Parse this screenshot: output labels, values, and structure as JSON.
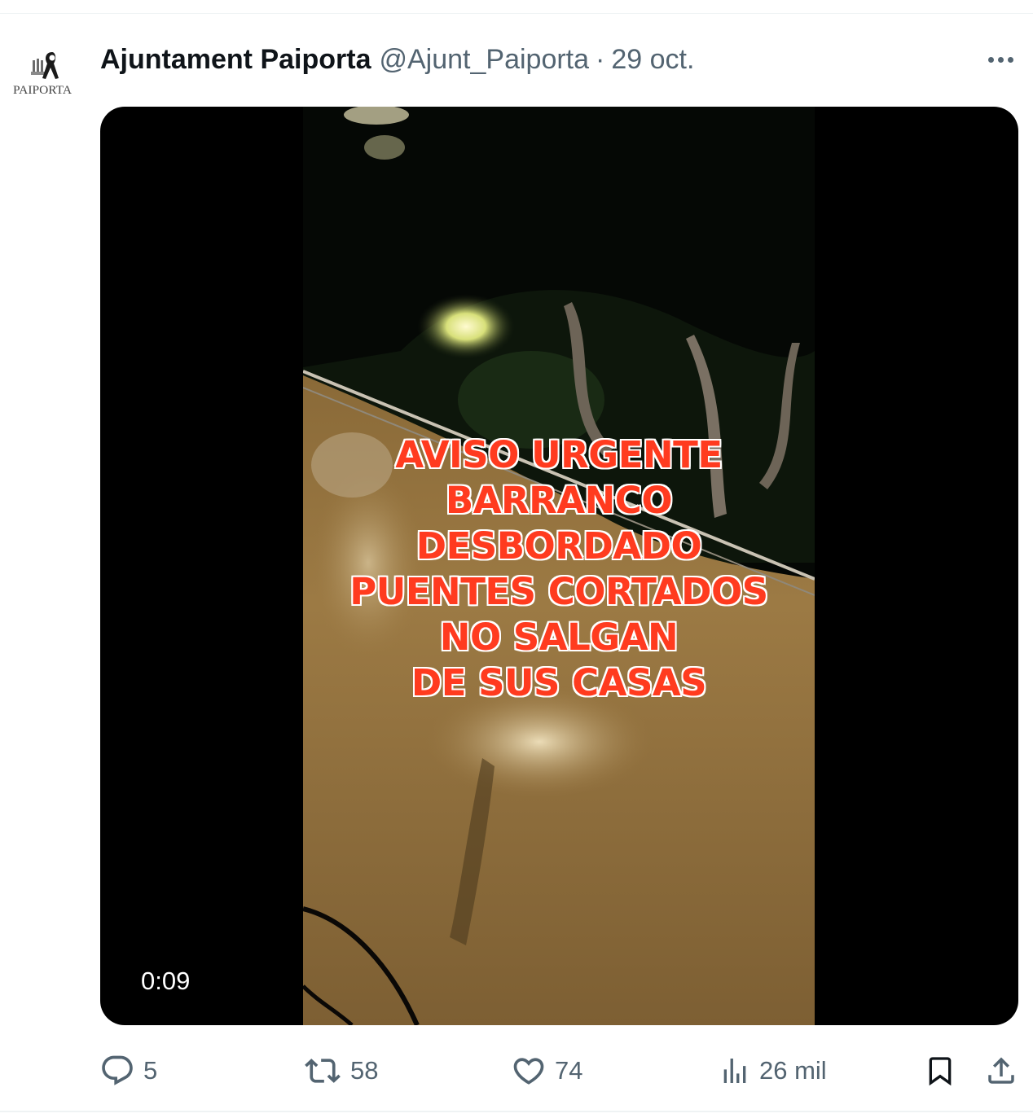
{
  "tweet": {
    "author": {
      "display_name": "Ajuntament Paiporta",
      "handle": "@Ajunt_Paiporta",
      "separator": "·",
      "date": "29 oct.",
      "avatar_text": "PAIPORTA"
    },
    "video": {
      "overlay_lines": [
        "AVISO URGENTE",
        "BARRANCO",
        "DESBORDADO",
        "PUENTES CORTADOS",
        "NO SALGAN",
        "DE SUS CASAS"
      ],
      "duration": "0:09"
    },
    "actions": {
      "replies": "5",
      "retweets": "58",
      "likes": "74",
      "views": "26 mil"
    }
  },
  "icons": {
    "more": "more-icon",
    "reply": "reply-icon",
    "retweet": "retweet-icon",
    "like": "heart-icon",
    "views": "views-icon",
    "bookmark": "bookmark-icon",
    "share": "share-icon"
  },
  "colors": {
    "text_primary": "#0f1419",
    "text_secondary": "#536471",
    "overlay_text": "#ff3b1f",
    "video_background": "#000000"
  }
}
